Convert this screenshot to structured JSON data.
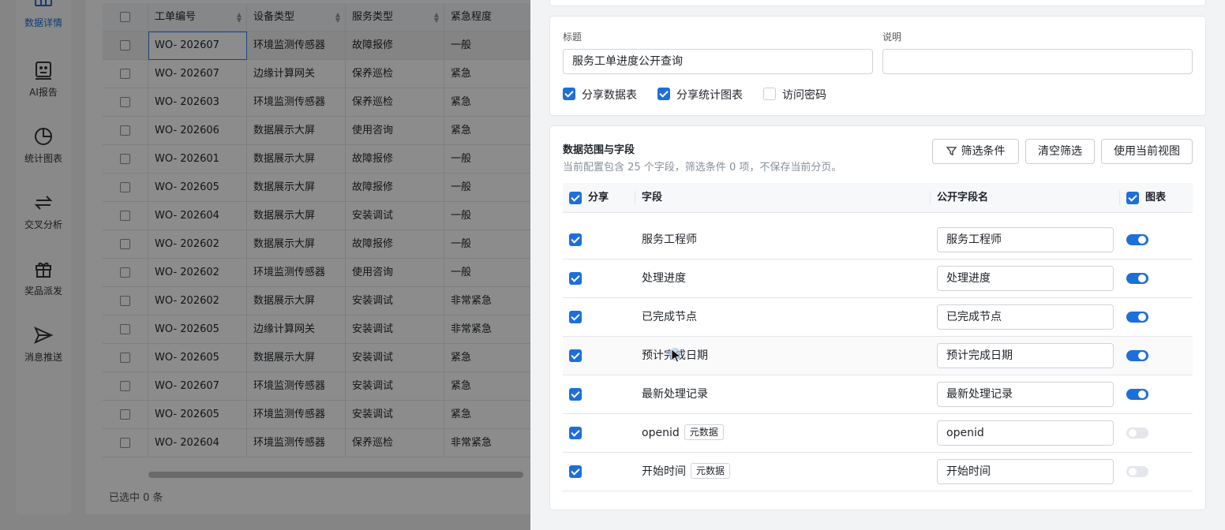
{
  "nav": [
    {
      "label": "数据详情",
      "icon": "table-icon",
      "active": true
    },
    {
      "label": "AI报告",
      "icon": "robot-icon"
    },
    {
      "label": "统计图表",
      "icon": "pie-chart-icon"
    },
    {
      "label": "交叉分析",
      "icon": "swap-icon"
    },
    {
      "label": "奖品派发",
      "icon": "gift-icon"
    },
    {
      "label": "消息推送",
      "icon": "send-icon"
    }
  ],
  "table": {
    "headers": [
      "工单编号",
      "设备类型",
      "服务类型",
      "紧急程度"
    ],
    "rows": [
      [
        "WO- 202607",
        "环境监测传感器",
        "故障报修",
        "一般"
      ],
      [
        "WO- 202607",
        "边缘计算网关",
        "保养巡检",
        "紧急"
      ],
      [
        "WO- 202603",
        "环境监测传感器",
        "保养巡检",
        "紧急"
      ],
      [
        "WO- 202606",
        "数据展示大屏",
        "使用咨询",
        "紧急"
      ],
      [
        "WO- 202601",
        "数据展示大屏",
        "故障报修",
        "一般"
      ],
      [
        "WO- 202605",
        "数据展示大屏",
        "故障报修",
        "一般"
      ],
      [
        "WO- 202604",
        "数据展示大屏",
        "安装调试",
        "一般"
      ],
      [
        "WO- 202602",
        "数据展示大屏",
        "故障报修",
        "一般"
      ],
      [
        "WO- 202602",
        "环境监测传感器",
        "使用咨询",
        "一般"
      ],
      [
        "WO- 202602",
        "数据展示大屏",
        "安装调试",
        "非常紧急"
      ],
      [
        "WO- 202605",
        "边缘计算网关",
        "安装调试",
        "非常紧急"
      ],
      [
        "WO- 202605",
        "数据展示大屏",
        "安装调试",
        "紧急"
      ],
      [
        "WO- 202607",
        "环境监测传感器",
        "安装调试",
        "紧急"
      ],
      [
        "WO- 202605",
        "环境监测传感器",
        "安装调试",
        "紧急"
      ],
      [
        "WO- 202604",
        "环境监测传感器",
        "保养巡检",
        "非常紧急"
      ]
    ],
    "footer": "已选中 0 条"
  },
  "share": {
    "title_label": "标题",
    "title_value": "服务工单进度公开查询",
    "desc_label": "说明",
    "desc_value": "",
    "opt_table": "分享数据表",
    "opt_chart": "分享统计图表",
    "opt_password": "访问密码"
  },
  "fields": {
    "title": "数据范围与字段",
    "subtitle": "当前配置包含 25 个字段，筛选条件 0 项，不保存当前分页。",
    "btn_filter": "筛选条件",
    "btn_clear": "清空筛选",
    "btn_view": "使用当前视图",
    "col_share": "分享",
    "col_field": "字段",
    "col_public": "公开字段名",
    "col_chart": "图表",
    "tag_meta": "元数据",
    "rows": [
      {
        "name": "服务工程师",
        "public": "服务工程师",
        "chart": true,
        "meta": false
      },
      {
        "name": "处理进度",
        "public": "处理进度",
        "chart": true,
        "meta": false
      },
      {
        "name": "已完成节点",
        "public": "已完成节点",
        "chart": true,
        "meta": false
      },
      {
        "name": "预计完成日期",
        "public": "预计完成日期",
        "chart": true,
        "meta": false
      },
      {
        "name": "最新处理记录",
        "public": "最新处理记录",
        "chart": true,
        "meta": false
      },
      {
        "name": "openid",
        "public": "openid",
        "chart": false,
        "meta": true
      },
      {
        "name": "开始时间",
        "public": "开始时间",
        "chart": false,
        "meta": true
      }
    ]
  },
  "colors": {
    "accent": "#1e6fd9",
    "overlay": "rgba(0,0,0,0.45)"
  }
}
